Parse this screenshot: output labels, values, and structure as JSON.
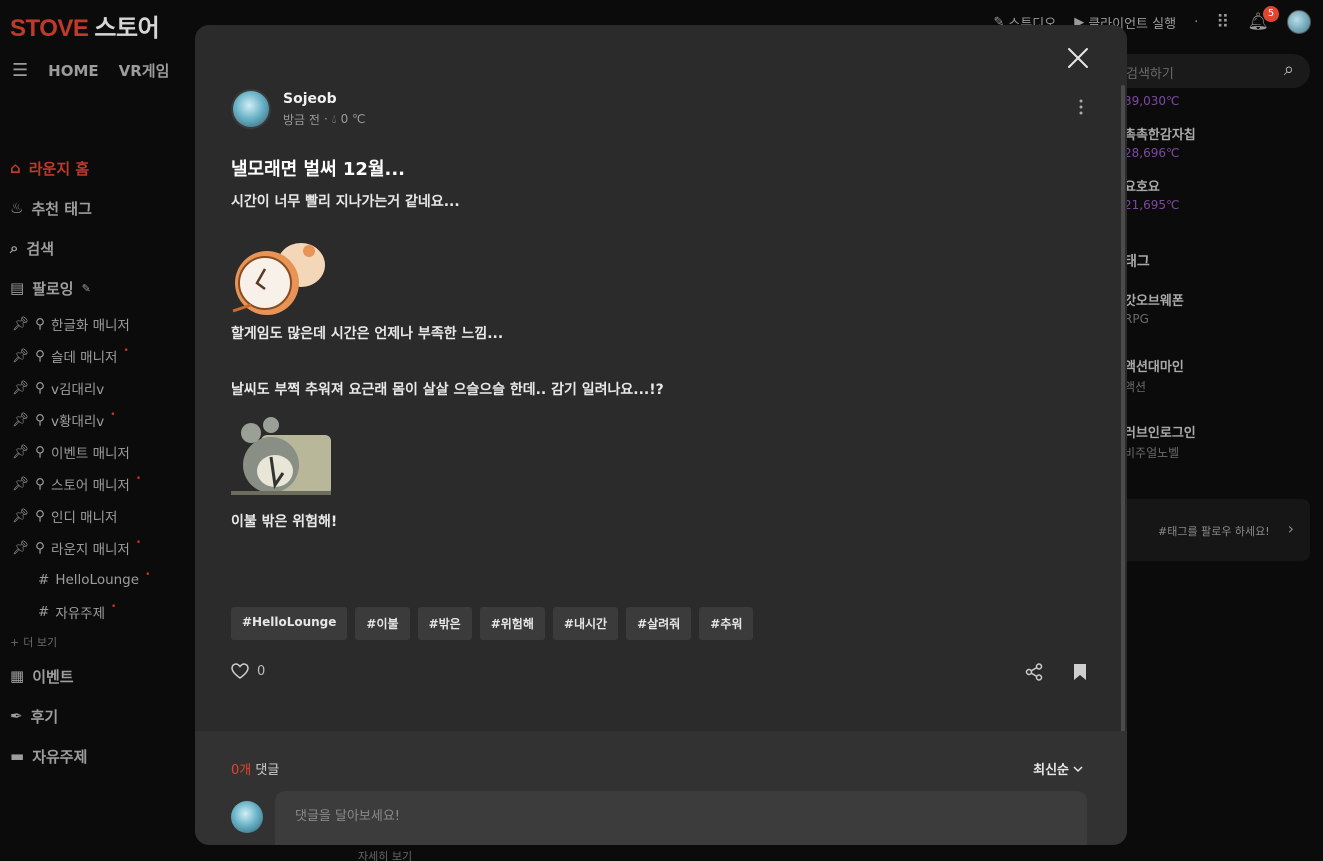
{
  "header": {
    "logo_stove": "STOVE",
    "logo_store": "스토어",
    "studio_label": "스튜디오",
    "client_label": "클라이언트 실행",
    "notif_count": "5"
  },
  "nav": {
    "home": "HOME",
    "vr": "VR게임"
  },
  "sidebar": {
    "main_items": [
      {
        "label": "라운지 홈"
      },
      {
        "label": "추천 태그"
      },
      {
        "label": "검색"
      },
      {
        "label": "팔로잉"
      }
    ],
    "following": [
      {
        "label": "한글화 매니저",
        "dot": false
      },
      {
        "label": "슬데 매니저",
        "dot": true
      },
      {
        "label": "v김대리v",
        "dot": false
      },
      {
        "label": "v황대리v",
        "dot": true
      },
      {
        "label": "이벤트 매니저",
        "dot": false
      },
      {
        "label": "스토어 매니저",
        "dot": true
      },
      {
        "label": "인디 매니저",
        "dot": false
      },
      {
        "label": "라운지 매니저",
        "dot": true
      },
      {
        "label": "HelloLounge",
        "dot": true
      },
      {
        "label": "자유주제",
        "dot": true
      }
    ],
    "more": "더 보기",
    "bottom_items": [
      {
        "label": "이벤트"
      },
      {
        "label": "후기"
      },
      {
        "label": "자유주제"
      }
    ]
  },
  "right": {
    "search_placeholder": "검색하기",
    "rank": [
      {
        "name": "",
        "temp": "39,030℃"
      },
      {
        "name": "촉촉한감자칩",
        "temp": "28,696℃"
      },
      {
        "name": "요호요",
        "temp": "21,695℃"
      }
    ],
    "tag_section": "태그",
    "tags": [
      {
        "name": "갓오브웨폰",
        "sub": "RPG"
      },
      {
        "name": "액션대마인",
        "sub": "액션"
      },
      {
        "name": "러브인로그인",
        "sub": "비주얼노벨"
      }
    ],
    "cta": "#태그를 팔로우 하세요!",
    "more_link": "자세히 보기"
  },
  "post": {
    "author": "Sojeob",
    "time": "방금 전",
    "temp": "0 ℃",
    "title": "낼모래면 벌써 12월...",
    "line1": "시간이 너무 빨리 지나가는거 같네요...",
    "line2": "할게임도 많은데 시간은 언제나 부족한 느낌...",
    "line3": "날씨도 부쩍 추워져 요근래 몸이 살살 으슬으슬 한데..  감기 일려나요...!?",
    "line4": "이불 밖은 위험해!",
    "tags": [
      "#HelloLounge",
      "#이불",
      "#밖은",
      "#위험해",
      "#내시간",
      "#살려줘",
      "#추워"
    ],
    "likes": "0"
  },
  "comments": {
    "count": "0개",
    "label": "댓글",
    "sort": "최신순",
    "placeholder": "댓글을 달아보세요!"
  },
  "colors": {
    "accent": "#e0452f",
    "brand": "#c0392b",
    "modal_bg": "#2b2b2b"
  }
}
